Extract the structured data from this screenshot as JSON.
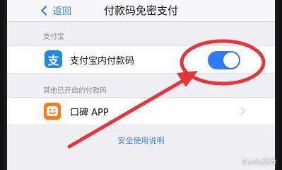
{
  "nav": {
    "back_label": "返回",
    "title": "付款码免密支付"
  },
  "sections": {
    "alipay_header": "支付宝",
    "others_header": "其他已开启的付款码"
  },
  "rows": {
    "alipay": {
      "icon_char": "支",
      "label": "支付宝内付款码",
      "toggle_on": true
    },
    "koubei": {
      "label": "口碑 APP"
    }
  },
  "footer_link": "安全使用说明",
  "watermark": "Baidu经验",
  "colors": {
    "accent": "#2f7bf5",
    "alipay_icon": "#1e88e5",
    "koubei_icon": "#ff7a1a",
    "annotation": "#e8323c"
  },
  "icons": {
    "back": "chevron-left-icon",
    "alipay": "alipay-icon",
    "koubei": "koubei-smile-icon",
    "disclosure": "chevron-right-icon"
  }
}
